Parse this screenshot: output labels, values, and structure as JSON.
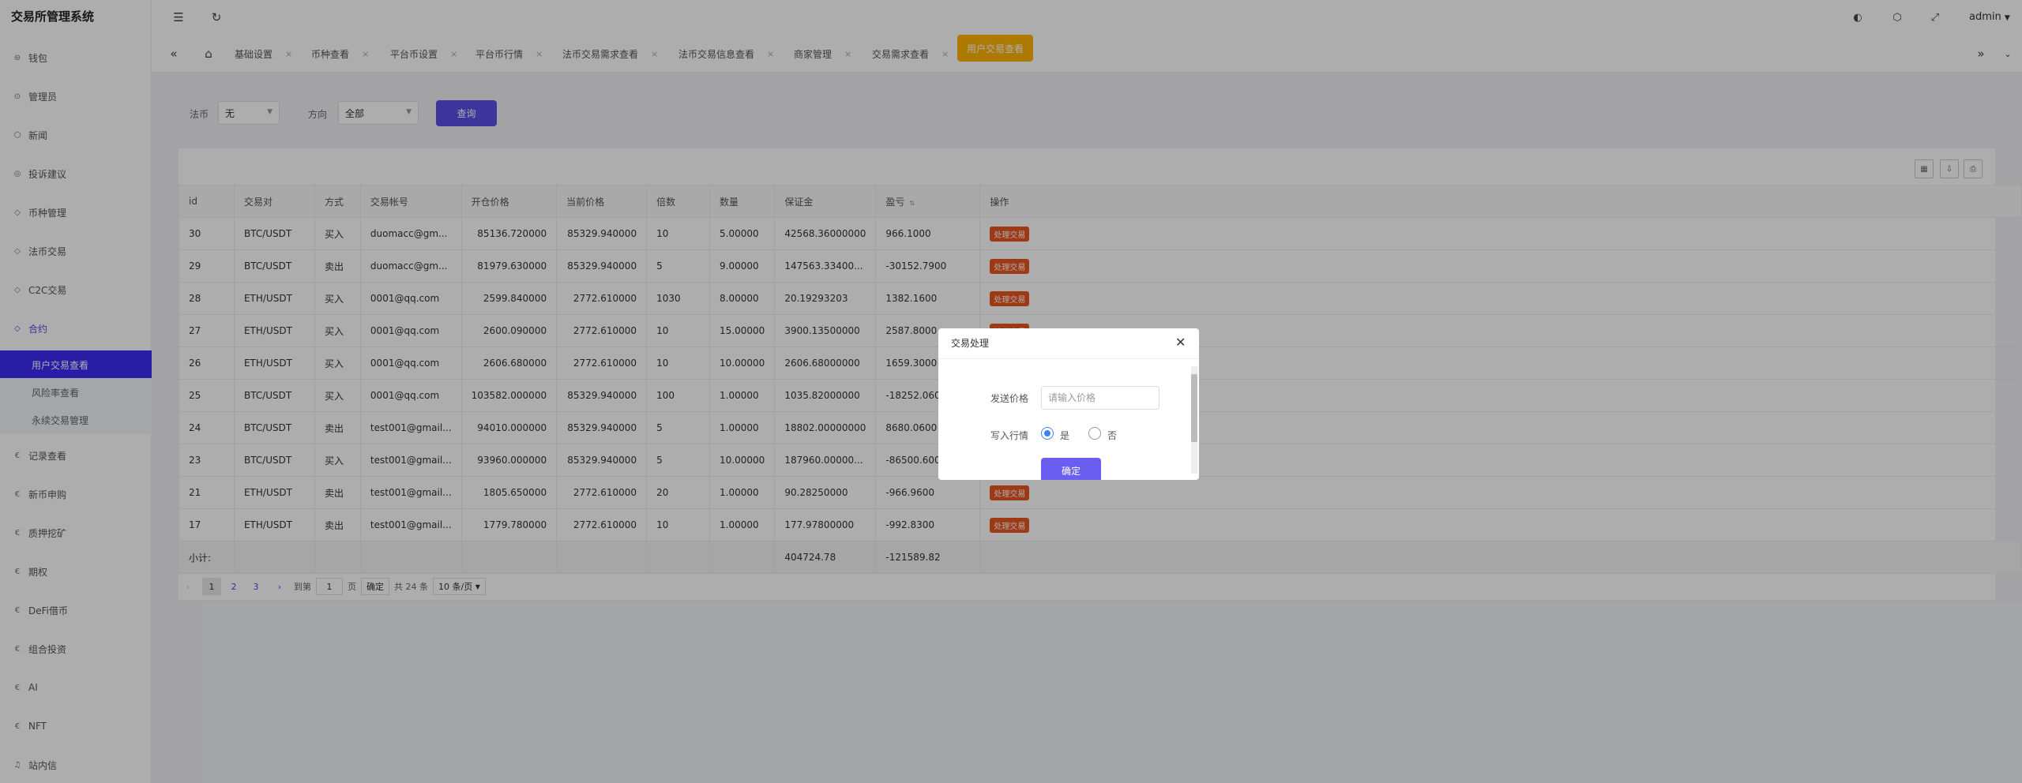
{
  "app": {
    "title": "交易所管理系统",
    "user": "admin"
  },
  "sidebar": {
    "items": [
      {
        "label": "钱包",
        "icon": "wallet-icon"
      },
      {
        "label": "管理员",
        "icon": "shield-icon"
      },
      {
        "label": "新闻",
        "icon": "tag-icon"
      },
      {
        "label": "投诉建议",
        "icon": "eye-icon"
      },
      {
        "label": "币种管理",
        "icon": "diamond-icon"
      },
      {
        "label": "法币交易",
        "icon": "diamond-icon"
      },
      {
        "label": "C2C交易",
        "icon": "diamond-icon"
      },
      {
        "label": "合约",
        "icon": "diamond-icon"
      }
    ],
    "submenu": [
      {
        "label": "用户交易查看",
        "active": true
      },
      {
        "label": "风险率查看",
        "active": false
      },
      {
        "label": "永续交易管理",
        "active": false
      }
    ],
    "items_after": [
      {
        "label": "记录查看",
        "icon": "euro-icon"
      },
      {
        "label": "新币申购",
        "icon": "euro-icon"
      },
      {
        "label": "质押挖矿",
        "icon": "euro-icon"
      },
      {
        "label": "期权",
        "icon": "euro-icon"
      },
      {
        "label": "DeFi借币",
        "icon": "euro-icon"
      },
      {
        "label": "组合投资",
        "icon": "euro-icon"
      },
      {
        "label": "AI",
        "icon": "euro-icon"
      },
      {
        "label": "NFT",
        "icon": "euro-icon"
      },
      {
        "label": "站内信",
        "icon": "bell-icon"
      }
    ]
  },
  "tabs": [
    {
      "label": "基础设置"
    },
    {
      "label": "币种查看"
    },
    {
      "label": "平台币设置"
    },
    {
      "label": "平台币行情"
    },
    {
      "label": "法币交易需求查看"
    },
    {
      "label": "法币交易信息查看"
    },
    {
      "label": "商家管理"
    },
    {
      "label": "交易需求查看"
    },
    {
      "label": "用户交易查看",
      "active": true
    }
  ],
  "filters": {
    "fiat_label": "法币",
    "fiat_value": "无",
    "direction_label": "方向",
    "direction_value": "全部",
    "query_label": "查询"
  },
  "table": {
    "headers": [
      "id",
      "交易对",
      "方式",
      "交易帐号",
      "开仓价格",
      "当前价格",
      "倍数",
      "数量",
      "保证金",
      "盈亏",
      "操作"
    ],
    "action_label": "处理交易",
    "rows": [
      [
        "30",
        "BTC/USDT",
        "买入",
        "duomacc@gm...",
        "85136.720000",
        "85329.940000",
        "10",
        "5.00000",
        "42568.36000000",
        "966.1000"
      ],
      [
        "29",
        "BTC/USDT",
        "卖出",
        "duomacc@gm...",
        "81979.630000",
        "85329.940000",
        "5",
        "9.00000",
        "147563.33400...",
        "-30152.7900"
      ],
      [
        "28",
        "ETH/USDT",
        "买入",
        "0001@qq.com",
        "2599.840000",
        "2772.610000",
        "1030",
        "8.00000",
        "20.19293203",
        "1382.1600"
      ],
      [
        "27",
        "ETH/USDT",
        "买入",
        "0001@qq.com",
        "2600.090000",
        "2772.610000",
        "10",
        "15.00000",
        "3900.13500000",
        "2587.8000"
      ],
      [
        "26",
        "ETH/USDT",
        "买入",
        "0001@qq.com",
        "2606.680000",
        "2772.610000",
        "10",
        "10.00000",
        "2606.68000000",
        "1659.3000"
      ],
      [
        "25",
        "BTC/USDT",
        "买入",
        "0001@qq.com",
        "103582.000000",
        "85329.940000",
        "100",
        "1.00000",
        "1035.82000000",
        "-18252.0600"
      ],
      [
        "24",
        "BTC/USDT",
        "卖出",
        "test001@gmail...",
        "94010.000000",
        "85329.940000",
        "5",
        "1.00000",
        "18802.00000000",
        "8680.0600"
      ],
      [
        "23",
        "BTC/USDT",
        "买入",
        "test001@gmail...",
        "93960.000000",
        "85329.940000",
        "5",
        "10.00000",
        "187960.00000...",
        "-86500.6000"
      ],
      [
        "21",
        "ETH/USDT",
        "卖出",
        "test001@gmail...",
        "1805.650000",
        "2772.610000",
        "20",
        "1.00000",
        "90.28250000",
        "-966.9600"
      ],
      [
        "17",
        "ETH/USDT",
        "卖出",
        "test001@gmail...",
        "1779.780000",
        "2772.610000",
        "10",
        "1.00000",
        "177.97800000",
        "-992.8300"
      ]
    ],
    "subtotal_label": "小计:",
    "subtotal_margin": "404724.78",
    "subtotal_pnl": "-121589.82"
  },
  "pagination": {
    "pages": [
      "1",
      "2",
      "3"
    ],
    "goto_label": "到第",
    "goto_value": "1",
    "page_unit": "页",
    "confirm": "确定",
    "total": "共 24 条",
    "page_size": "10 条/页"
  },
  "modal": {
    "title": "交易处理",
    "price_label": "发送价格",
    "price_placeholder": "请输入价格",
    "write_label": "写入行情",
    "yes_label": "是",
    "no_label": "否",
    "confirm_label": "确定"
  }
}
